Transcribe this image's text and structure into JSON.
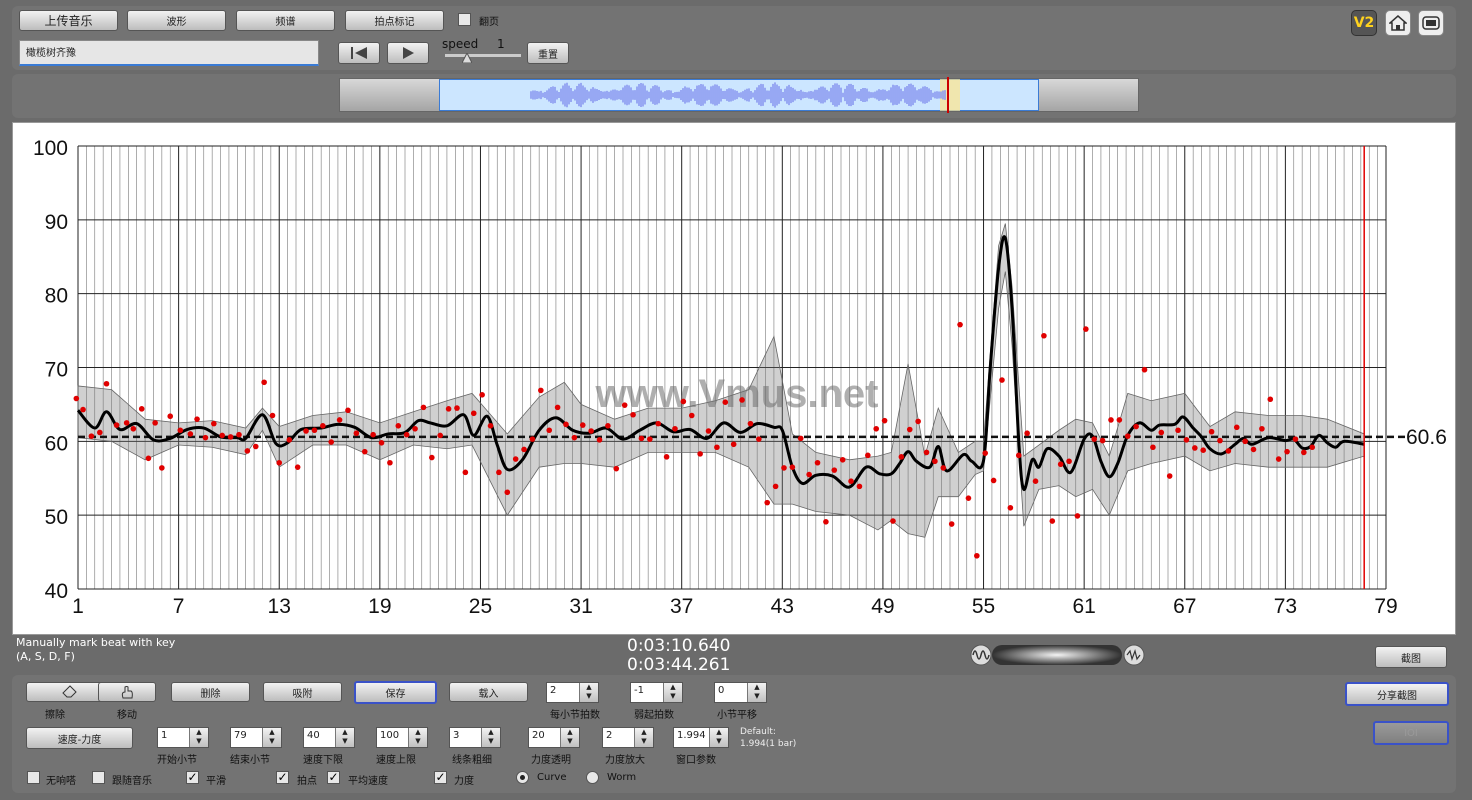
{
  "top": {
    "upload_label": "上传音乐",
    "waveform_label": "波形",
    "spectrum_label": "频谱",
    "beatmark_label": "拍点标记",
    "pageturn_label": "翻页",
    "song_title": "橄榄树齐豫",
    "speed_label": "speed",
    "speed_value": "1",
    "reset_label": "重置",
    "v2_label": "V2"
  },
  "chart_data": {
    "type": "line",
    "xlabel": "",
    "ylabel": "",
    "xlim": [
      1,
      79
    ],
    "ylim": [
      40,
      100
    ],
    "x_ticks": [
      "1",
      "7",
      "13",
      "19",
      "25",
      "31",
      "37",
      "43",
      "49",
      "55",
      "61",
      "67",
      "73",
      "79"
    ],
    "y_ticks": [
      "100",
      "90",
      "80",
      "70",
      "60",
      "50",
      "40"
    ],
    "watermark": "www.Vmus.net",
    "average_value": 60.6,
    "average_label": "60.6",
    "cursor_x": 77.7,
    "curve": [
      [
        1,
        64.2
      ],
      [
        2,
        61.8
      ],
      [
        2.7,
        64
      ],
      [
        3.5,
        61.6
      ],
      [
        4.5,
        62.4
      ],
      [
        5.5,
        60.2
      ],
      [
        6.5,
        60.4
      ],
      [
        7.5,
        61.6
      ],
      [
        8.5,
        61.8
      ],
      [
        9.5,
        60.6
      ],
      [
        10.5,
        60.5
      ],
      [
        11,
        60.4
      ],
      [
        12,
        63.6
      ],
      [
        12.8,
        59.7
      ],
      [
        13.5,
        59.8
      ],
      [
        14.3,
        61.6
      ],
      [
        15.5,
        61.8
      ],
      [
        16.5,
        62.3
      ],
      [
        17.5,
        61.9
      ],
      [
        18.5,
        60.5
      ],
      [
        19.5,
        61
      ],
      [
        20.5,
        61.2
      ],
      [
        21.3,
        62.8
      ],
      [
        22,
        62.5
      ],
      [
        23,
        62.1
      ],
      [
        24,
        63.6
      ],
      [
        24.6,
        60.8
      ],
      [
        25.4,
        63.4
      ],
      [
        26,
        59.5
      ],
      [
        26.6,
        56.2
      ],
      [
        27.5,
        57.5
      ],
      [
        28.5,
        61.5
      ],
      [
        29.5,
        63.2
      ],
      [
        30.5,
        61.5
      ],
      [
        31.5,
        61.1
      ],
      [
        32.5,
        61.8
      ],
      [
        33.5,
        60.3
      ],
      [
        34.5,
        61.5
      ],
      [
        35.5,
        62.5
      ],
      [
        36.5,
        61.3
      ],
      [
        37.5,
        61.6
      ],
      [
        38.5,
        60.4
      ],
      [
        39.5,
        62.5
      ],
      [
        40.5,
        61.2
      ],
      [
        41.5,
        62.4
      ],
      [
        42.5,
        61.9
      ],
      [
        43,
        61.5
      ],
      [
        43.6,
        56.5
      ],
      [
        44.2,
        54.3
      ],
      [
        45,
        55.4
      ],
      [
        46,
        55.3
      ],
      [
        47,
        53.8
      ],
      [
        48,
        56.5
      ],
      [
        48.8,
        55.6
      ],
      [
        49.5,
        55.6
      ],
      [
        50,
        57
      ],
      [
        50.5,
        58.6
      ],
      [
        51,
        57.3
      ],
      [
        51.8,
        56.5
      ],
      [
        52.3,
        59.3
      ],
      [
        52.8,
        56
      ],
      [
        53.8,
        58.2
      ],
      [
        54.3,
        57.3
      ],
      [
        55,
        57.4
      ],
      [
        55.4,
        70
      ],
      [
        55.9,
        83.5
      ],
      [
        56.3,
        87.5
      ],
      [
        56.7,
        78
      ],
      [
        57.1,
        60
      ],
      [
        57.4,
        53.5
      ],
      [
        57.9,
        57.5
      ],
      [
        58.3,
        56.5
      ],
      [
        58.8,
        59
      ],
      [
        59.5,
        58
      ],
      [
        60.2,
        55.8
      ],
      [
        61,
        60.3
      ],
      [
        61.5,
        60.7
      ],
      [
        62,
        57.3
      ],
      [
        62.5,
        55.2
      ],
      [
        63,
        57
      ],
      [
        63.6,
        60.8
      ],
      [
        64.3,
        62.5
      ],
      [
        65,
        61.5
      ],
      [
        65.5,
        62.2
      ],
      [
        66.4,
        62.3
      ],
      [
        66.9,
        63.3
      ],
      [
        67.5,
        61.8
      ],
      [
        68,
        60.6
      ],
      [
        68.5,
        59
      ],
      [
        69.2,
        58.3
      ],
      [
        70,
        59.6
      ],
      [
        70.5,
        60.4
      ],
      [
        71,
        59.6
      ],
      [
        72,
        60.5
      ],
      [
        73,
        60.1
      ],
      [
        73.5,
        60.3
      ],
      [
        74,
        59.1
      ],
      [
        74.5,
        59.3
      ],
      [
        75,
        60.8
      ],
      [
        75.5,
        59.8
      ],
      [
        76,
        59.2
      ],
      [
        76.5,
        60
      ],
      [
        77.7,
        59.6
      ]
    ],
    "band": [
      [
        1,
        67.5,
        60.5
      ],
      [
        3,
        67,
        60
      ],
      [
        5,
        63,
        57.5
      ],
      [
        7,
        62.5,
        59.5
      ],
      [
        9,
        62.8,
        59.2
      ],
      [
        11,
        61.8,
        58.2
      ],
      [
        12,
        64.5,
        61.5
      ],
      [
        13,
        62,
        56.5
      ],
      [
        15,
        63.5,
        59.5
      ],
      [
        17,
        64,
        59.5
      ],
      [
        19,
        62.5,
        57.5
      ],
      [
        21,
        64,
        59.5
      ],
      [
        23,
        65.5,
        59
      ],
      [
        24.5,
        66.5,
        59.5
      ],
      [
        26.6,
        61,
        50
      ],
      [
        28.5,
        66,
        56.5
      ],
      [
        30,
        68,
        57
      ],
      [
        31,
        65,
        57
      ],
      [
        33,
        63,
        56.5
      ],
      [
        35,
        64.5,
        58.5
      ],
      [
        37,
        64.5,
        58.5
      ],
      [
        39,
        65.5,
        58.5
      ],
      [
        41,
        67,
        56.5
      ],
      [
        42.5,
        74.2,
        51.5
      ],
      [
        43.6,
        61,
        51.5
      ],
      [
        45,
        58.5,
        50.5
      ],
      [
        47,
        57.5,
        50
      ],
      [
        48.7,
        58,
        48
      ],
      [
        49.5,
        58.5,
        49.3
      ],
      [
        50.5,
        70.5,
        47.5
      ],
      [
        51.5,
        58,
        47
      ],
      [
        52.3,
        64.5,
        52.5
      ],
      [
        53.5,
        58.5,
        52.5
      ],
      [
        54.5,
        60,
        55.5
      ],
      [
        55,
        60,
        56
      ],
      [
        55.9,
        86.5,
        78
      ],
      [
        56.3,
        89.5,
        83
      ],
      [
        56.7,
        81,
        73
      ],
      [
        57.4,
        58,
        48.5
      ],
      [
        58.3,
        59.5,
        53.5
      ],
      [
        59.5,
        61.5,
        54
      ],
      [
        60.5,
        63,
        52.5
      ],
      [
        61.5,
        62.5,
        53.5
      ],
      [
        62.5,
        58,
        50
      ],
      [
        63.6,
        66.5,
        56
      ],
      [
        65,
        65.5,
        57
      ],
      [
        67,
        66.5,
        58
      ],
      [
        68.5,
        62,
        56
      ],
      [
        70,
        64,
        57
      ],
      [
        72,
        63.5,
        56.5
      ],
      [
        74,
        63.5,
        56.5
      ],
      [
        75.5,
        63,
        56.5
      ],
      [
        77.7,
        61,
        58
      ]
    ],
    "points": [
      [
        0.9,
        65.8
      ],
      [
        1.3,
        64.3
      ],
      [
        1.8,
        60.7
      ],
      [
        2.3,
        61.2
      ],
      [
        2.7,
        67.8
      ],
      [
        3.3,
        62.2
      ],
      [
        3.9,
        62.5
      ],
      [
        4.3,
        61.7
      ],
      [
        4.8,
        64.4
      ],
      [
        5.2,
        57.7
      ],
      [
        5.6,
        62.5
      ],
      [
        6,
        56.4
      ],
      [
        6.5,
        63.4
      ],
      [
        7.1,
        61.5
      ],
      [
        7.7,
        61
      ],
      [
        8.1,
        63
      ],
      [
        8.6,
        60.5
      ],
      [
        9.1,
        62.4
      ],
      [
        9.6,
        60.8
      ],
      [
        10.1,
        60.6
      ],
      [
        10.6,
        60.9
      ],
      [
        11.1,
        58.7
      ],
      [
        11.6,
        59.3
      ],
      [
        12.1,
        68
      ],
      [
        12.6,
        63.5
      ],
      [
        13,
        57.1
      ],
      [
        13.6,
        60.2
      ],
      [
        14.1,
        56.5
      ],
      [
        14.6,
        61.4
      ],
      [
        15.1,
        61.5
      ],
      [
        15.6,
        62.1
      ],
      [
        16.1,
        59.9
      ],
      [
        16.6,
        62.9
      ],
      [
        17.1,
        64.2
      ],
      [
        17.6,
        61.1
      ],
      [
        18.1,
        58.6
      ],
      [
        18.6,
        60.9
      ],
      [
        19.1,
        59.8
      ],
      [
        19.6,
        57.1
      ],
      [
        20.1,
        62.1
      ],
      [
        20.6,
        60.9
      ],
      [
        21.1,
        61.7
      ],
      [
        21.6,
        64.6
      ],
      [
        22.1,
        57.8
      ],
      [
        22.6,
        60.8
      ],
      [
        23.1,
        64.4
      ],
      [
        23.6,
        64.5
      ],
      [
        24.1,
        55.8
      ],
      [
        24.6,
        63.8
      ],
      [
        25.1,
        66.3
      ],
      [
        25.6,
        62.1
      ],
      [
        26.1,
        55.8
      ],
      [
        26.6,
        53.1
      ],
      [
        27.1,
        57.6
      ],
      [
        27.6,
        58.9
      ],
      [
        28.1,
        60.3
      ],
      [
        28.6,
        66.9
      ],
      [
        29.1,
        61.5
      ],
      [
        29.6,
        64.6
      ],
      [
        30.1,
        62.3
      ],
      [
        30.6,
        60.5
      ],
      [
        31.1,
        62.2
      ],
      [
        31.6,
        61.4
      ],
      [
        32.1,
        60.2
      ],
      [
        32.6,
        62.1
      ],
      [
        33.1,
        56.3
      ],
      [
        33.6,
        64.9
      ],
      [
        34.1,
        63.6
      ],
      [
        34.6,
        60.4
      ],
      [
        35.1,
        60.3
      ],
      [
        35.6,
        62.4
      ],
      [
        36.1,
        57.9
      ],
      [
        36.6,
        61.7
      ],
      [
        37.1,
        65.4
      ],
      [
        37.6,
        63.5
      ],
      [
        38.1,
        58.3
      ],
      [
        38.6,
        61.4
      ],
      [
        39.1,
        59.2
      ],
      [
        39.6,
        65.3
      ],
      [
        40.1,
        59.6
      ],
      [
        40.6,
        65.6
      ],
      [
        41.1,
        62.4
      ],
      [
        41.6,
        60.3
      ],
      [
        42.1,
        51.7
      ],
      [
        42.6,
        53.9
      ],
      [
        43.1,
        56.4
      ],
      [
        43.6,
        56.5
      ],
      [
        44.1,
        60.4
      ],
      [
        44.6,
        55.5
      ],
      [
        45.1,
        57.1
      ],
      [
        45.6,
        49.1
      ],
      [
        46.1,
        56.1
      ],
      [
        46.6,
        57.5
      ],
      [
        47.1,
        54.6
      ],
      [
        47.6,
        53.9
      ],
      [
        48.1,
        58.1
      ],
      [
        48.6,
        61.7
      ],
      [
        49.1,
        62.8
      ],
      [
        49.6,
        49.2
      ],
      [
        50.1,
        57.9
      ],
      [
        50.6,
        61.6
      ],
      [
        51.1,
        62.7
      ],
      [
        51.6,
        58.5
      ],
      [
        52.1,
        57.3
      ],
      [
        52.6,
        56.4
      ],
      [
        53.1,
        48.8
      ],
      [
        53.6,
        75.8
      ],
      [
        54.1,
        52.3
      ],
      [
        54.6,
        44.5
      ],
      [
        55.1,
        58.4
      ],
      [
        55.6,
        54.7
      ],
      [
        56.1,
        68.3
      ],
      [
        56.6,
        51
      ],
      [
        57.1,
        58.1
      ],
      [
        57.6,
        61.1
      ],
      [
        58.1,
        54.6
      ],
      [
        58.6,
        74.3
      ],
      [
        59.1,
        49.2
      ],
      [
        59.6,
        56.9
      ],
      [
        60.1,
        57.3
      ],
      [
        60.6,
        49.9
      ],
      [
        61.1,
        75.2
      ],
      [
        61.6,
        60.3
      ],
      [
        62.1,
        60.1
      ],
      [
        62.6,
        62.9
      ],
      [
        63.1,
        62.9
      ],
      [
        63.6,
        60.7
      ],
      [
        64.1,
        62
      ],
      [
        64.6,
        69.7
      ],
      [
        65.1,
        59.2
      ],
      [
        65.6,
        61.2
      ],
      [
        66.1,
        55.3
      ],
      [
        66.6,
        61.5
      ],
      [
        67.1,
        60.2
      ],
      [
        67.6,
        59.1
      ],
      [
        68.1,
        58.8
      ],
      [
        68.6,
        61.3
      ],
      [
        69.1,
        60.1
      ],
      [
        69.6,
        58.7
      ],
      [
        70.1,
        61.9
      ],
      [
        70.6,
        60
      ],
      [
        71.1,
        58.9
      ],
      [
        71.6,
        61.7
      ],
      [
        72.1,
        65.7
      ],
      [
        72.6,
        57.6
      ],
      [
        73.1,
        58.6
      ],
      [
        73.6,
        60.3
      ],
      [
        74.1,
        58.5
      ],
      [
        74.6,
        59.2
      ]
    ]
  },
  "info": {
    "hint_line1": "Manually mark beat with key",
    "hint_line2": "(A, S, D, F)",
    "time_current": "0:03:10.640",
    "time_total": "0:03:44.261",
    "screenshot_label": "截图"
  },
  "controls": {
    "erase_label": "擦除",
    "move_label": "移动",
    "delete_label": "删除",
    "snap_label": "吸附",
    "save_label": "保存",
    "load_label": "载入",
    "share_label": "分享截图",
    "ioi_label": "IOI",
    "mode_label": "速度-力度",
    "beats_per_bar": {
      "value": "2",
      "label": "每小节拍数"
    },
    "pickup_beat": {
      "value": "-1",
      "label": "弱起拍数"
    },
    "bar_shift": {
      "value": "0",
      "label": "小节平移"
    },
    "start_bar": {
      "value": "1",
      "label": "开始小节"
    },
    "end_bar": {
      "value": "79",
      "label": "结束小节"
    },
    "tempo_min": {
      "value": "40",
      "label": "速度下限"
    },
    "tempo_max": {
      "value": "100",
      "label": "速度上限"
    },
    "line_width": {
      "value": "3",
      "label": "线条粗细"
    },
    "dyn_opacity": {
      "value": "20",
      "label": "力度透明"
    },
    "dyn_scale": {
      "value": "2",
      "label": "力度放大"
    },
    "window_param": {
      "value": "1.994",
      "label": "窗口参数"
    },
    "default_line1": "Default:",
    "default_line2": "1.994(1 bar)",
    "cb_no_click": "无响嗒",
    "cb_follow": "跟随音乐",
    "cb_smooth": "平滑",
    "cb_beats": "拍点",
    "cb_avg_tempo": "平均速度",
    "cb_dynamics": "力度",
    "radio_curve": "Curve",
    "radio_worm": "Worm"
  }
}
